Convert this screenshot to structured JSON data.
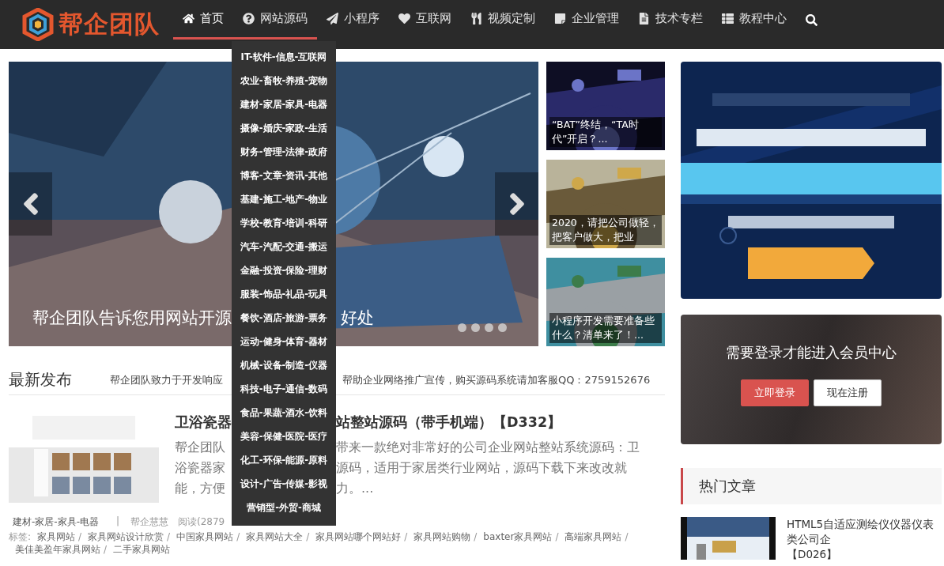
{
  "header": {
    "logo_text": "帮企团队",
    "nav": [
      {
        "label": "首页",
        "selected": true,
        "expanded": false
      },
      {
        "label": "网站源码",
        "selected": false,
        "expanded": true
      },
      {
        "label": "小程序",
        "selected": false,
        "expanded": false
      },
      {
        "label": "互联网",
        "selected": false,
        "expanded": false
      },
      {
        "label": "视频定制",
        "selected": false,
        "expanded": false
      },
      {
        "label": "企业管理",
        "selected": false,
        "expanded": false
      },
      {
        "label": "技术专栏",
        "selected": false,
        "expanded": false
      },
      {
        "label": "教程中心",
        "selected": false,
        "expanded": false
      }
    ],
    "dropdown": [
      "IT-软件-信息-互联网",
      "农业-畜牧-养殖-宠物",
      "建材-家居-家具-电器",
      "摄像-婚庆-家政-生活",
      "财务-管理-法律-政府",
      "博客-文章-资讯-其他",
      "基建-施工-地产-物业",
      "学校-教育-培训-科研",
      "汽车-汽配-交通-搬运",
      "金融-投资-保险-理财",
      "服装-饰品-礼品-玩具",
      "餐饮-酒店-旅游-票务",
      "运动-健身-体育-器材",
      "机械-设备-制造-仪器",
      "科技-电子-通信-数码",
      "食品-果蔬-酒水-饮料",
      "美容-保健-医院-医疗",
      "化工-环保-能源-原料",
      "设计-广告-传媒-影视",
      "营销型-外贸-商城"
    ]
  },
  "slider": {
    "caption_parts": [
      "帮企团队告诉您用网站开源",
      "好处"
    ],
    "dots": [
      {
        "selected": false
      },
      {
        "selected": false
      },
      {
        "selected": false
      },
      {
        "selected": false
      }
    ]
  },
  "side_posts": [
    {
      "caption": "“BAT”终结，“TA时代”开启？..."
    },
    {
      "caption": "2020，请把公司做轻，把客户做大，把业"
    },
    {
      "caption": "小程序开发需要准备些什么？清单来了！..."
    }
  ],
  "latest": {
    "title": "最新发布",
    "notice_parts": [
      "帮企团队致力于开发响应",
      "帮助企业网络推广宣传，购买源码系统请加客服QQ：2759152676"
    ],
    "article": {
      "title_parts": [
        "卫浴瓷器",
        "站整站源码（带手机端）【D332】"
      ],
      "excerpt_lines": [
        [
          "帮企团队",
          "带来一款绝对非常好的公司企业网站整站系统源码：卫"
        ],
        [
          "浴瓷器家",
          "源码，适用于家居类行业网站，源码下载下来改改就"
        ],
        [
          "能，方便",
          "力。..."
        ]
      ],
      "category": "建材-家居-家具-电器",
      "divider": "|",
      "author": "帮企慧慧",
      "reads": "阅读(2879",
      "tags_label": "标签:",
      "tag_separator": "/",
      "tags": [
        "家具网站",
        "家具网站设计欣赏",
        "中国家具网站",
        "家具网站大全",
        "家具网站哪个网站好",
        "家具网站购物",
        "baxter家具网站",
        "高端家具网站",
        "美佳美盈年家具网站",
        "二手家具网站"
      ]
    }
  },
  "member": {
    "message": "需要登录才能进入会员中心",
    "buttons": [
      {
        "label": "立即登录",
        "kind": "primary"
      },
      {
        "label": "现在注册",
        "kind": "default"
      }
    ]
  },
  "hot": {
    "title": "热门文章",
    "items": [
      {
        "title_lines": [
          "HTML5自适应测绘仪仪器仪表",
          "类公司企",
          "【D026】"
        ]
      }
    ]
  }
}
